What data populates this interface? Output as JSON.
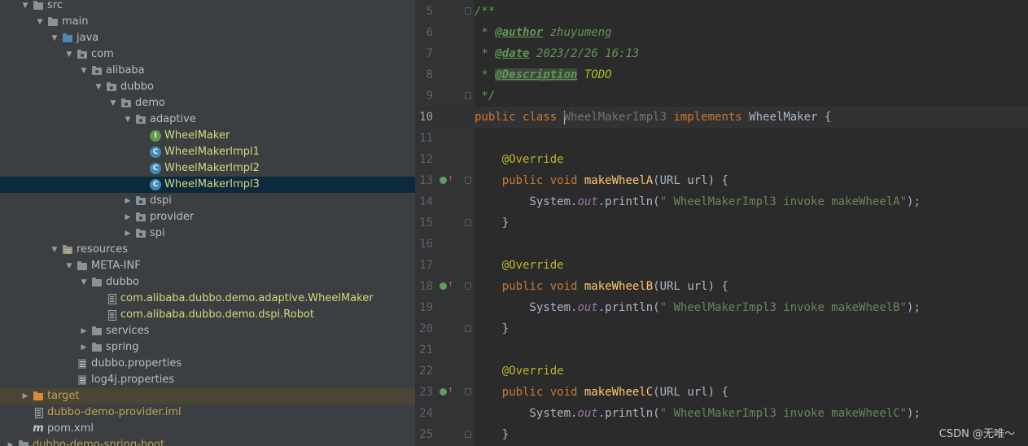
{
  "tree": [
    {
      "label": "src",
      "level": 1,
      "arrow": "open",
      "icon": "folder-icon"
    },
    {
      "label": "main",
      "level": 2,
      "arrow": "open",
      "icon": "folder-icon"
    },
    {
      "label": "java",
      "level": 3,
      "arrow": "open",
      "icon": "source-folder-icon"
    },
    {
      "label": "com",
      "level": 4,
      "arrow": "open",
      "icon": "package-icon"
    },
    {
      "label": "alibaba",
      "level": 5,
      "arrow": "open",
      "icon": "package-icon"
    },
    {
      "label": "dubbo",
      "level": 6,
      "arrow": "open",
      "icon": "package-icon"
    },
    {
      "label": "demo",
      "level": 7,
      "arrow": "open",
      "icon": "package-icon"
    },
    {
      "label": "adaptive",
      "level": 8,
      "arrow": "open",
      "icon": "package-icon"
    },
    {
      "label": "WheelMaker",
      "level": 9,
      "arrow": "none",
      "icon": "interface-icon",
      "color": "green"
    },
    {
      "label": "WheelMakerImpl1",
      "level": 9,
      "arrow": "none",
      "icon": "class-icon",
      "color": "green"
    },
    {
      "label": "WheelMakerImpl2",
      "level": 9,
      "arrow": "none",
      "icon": "class-icon",
      "color": "green"
    },
    {
      "label": "WheelMakerImpl3",
      "level": 9,
      "arrow": "none",
      "icon": "class-icon",
      "color": "green",
      "selected": true
    },
    {
      "label": "dspi",
      "level": 8,
      "arrow": "closed",
      "icon": "package-icon"
    },
    {
      "label": "provider",
      "level": 8,
      "arrow": "closed",
      "icon": "package-icon"
    },
    {
      "label": "spi",
      "level": 8,
      "arrow": "closed",
      "icon": "package-icon"
    },
    {
      "label": "resources",
      "level": 3,
      "arrow": "open",
      "icon": "resources-folder-icon"
    },
    {
      "label": "META-INF",
      "level": 4,
      "arrow": "open",
      "icon": "folder-icon"
    },
    {
      "label": "dubbo",
      "level": 5,
      "arrow": "open",
      "icon": "folder-icon"
    },
    {
      "label": "com.alibaba.dubbo.demo.adaptive.WheelMaker",
      "level": 6,
      "arrow": "none",
      "icon": "file-icon",
      "color": "green"
    },
    {
      "label": "com.alibaba.dubbo.demo.dspi.Robot",
      "level": 6,
      "arrow": "none",
      "icon": "file-icon",
      "color": "green"
    },
    {
      "label": "services",
      "level": 5,
      "arrow": "closed",
      "icon": "folder-icon"
    },
    {
      "label": "spring",
      "level": 5,
      "arrow": "closed",
      "icon": "folder-icon"
    },
    {
      "label": "dubbo.properties",
      "level": 4,
      "arrow": "none",
      "icon": "properties-icon"
    },
    {
      "label": "log4j.properties",
      "level": 4,
      "arrow": "none",
      "icon": "properties-icon"
    },
    {
      "label": "target",
      "level": 1,
      "arrow": "closed",
      "icon": "target-folder-icon",
      "color": "orange",
      "excluded": true
    },
    {
      "label": "dubbo-demo-provider.iml",
      "level": 1,
      "arrow": "none",
      "icon": "iml-file-icon",
      "color": "orange"
    },
    {
      "label": "pom.xml",
      "level": 1,
      "arrow": "none",
      "icon": "maven-icon"
    },
    {
      "label": "dubbo-demo-spring-boot",
      "level": 0,
      "arrow": "closed",
      "icon": "folder-icon",
      "color": "orange"
    }
  ],
  "editor": {
    "current_line": "10",
    "lines": [
      {
        "no": "5",
        "fold": "open",
        "tokens": [
          [
            "cm",
            "/**"
          ]
        ]
      },
      {
        "no": "6",
        "tokens": [
          [
            "cm",
            " * "
          ],
          [
            "tag",
            "@author"
          ],
          [
            "cm",
            " zhuyumeng"
          ]
        ]
      },
      {
        "no": "7",
        "tokens": [
          [
            "cm",
            " * "
          ],
          [
            "tag",
            "@date"
          ],
          [
            "cm",
            " 2023/2/26 16:13"
          ]
        ]
      },
      {
        "no": "8",
        "tokens": [
          [
            "cm",
            " * "
          ],
          [
            "tag tagbox",
            "@Description"
          ],
          [
            "cm",
            " "
          ],
          [
            "todo",
            "TODO"
          ]
        ]
      },
      {
        "no": "9",
        "fold": "close",
        "tokens": [
          [
            "cm",
            " */"
          ]
        ]
      },
      {
        "no": "10",
        "current": true,
        "tokens": [
          [
            "kw",
            "public class "
          ],
          [
            "caret",
            ""
          ],
          [
            "cls-unused",
            "WheelMakerImpl3"
          ],
          [
            "kw",
            " implements "
          ],
          [
            "pl",
            "WheelMaker {"
          ]
        ]
      },
      {
        "no": "11",
        "tokens": []
      },
      {
        "no": "12",
        "tokens": [
          [
            "pl",
            "    "
          ],
          [
            "ann",
            "@Override"
          ]
        ]
      },
      {
        "no": "13",
        "fold": "open",
        "impl": true,
        "tokens": [
          [
            "pl",
            "    "
          ],
          [
            "kw",
            "public void "
          ],
          [
            "fn",
            "makeWheelA"
          ],
          [
            "pl",
            "(URL url) {"
          ]
        ]
      },
      {
        "no": "14",
        "tokens": [
          [
            "pl",
            "        System."
          ],
          [
            "st",
            "out"
          ],
          [
            "pl",
            ".println("
          ],
          [
            "str",
            "\" WheelMakerImpl3 invoke makeWheelA\""
          ],
          [
            "pl",
            ");"
          ]
        ]
      },
      {
        "no": "15",
        "fold": "close",
        "tokens": [
          [
            "pl",
            "    }"
          ]
        ]
      },
      {
        "no": "16",
        "tokens": []
      },
      {
        "no": "17",
        "tokens": [
          [
            "pl",
            "    "
          ],
          [
            "ann",
            "@Override"
          ]
        ]
      },
      {
        "no": "18",
        "fold": "open",
        "impl": true,
        "tokens": [
          [
            "pl",
            "    "
          ],
          [
            "kw",
            "public void "
          ],
          [
            "fn",
            "makeWheelB"
          ],
          [
            "pl",
            "(URL url) {"
          ]
        ]
      },
      {
        "no": "19",
        "tokens": [
          [
            "pl",
            "        System."
          ],
          [
            "st",
            "out"
          ],
          [
            "pl",
            ".println("
          ],
          [
            "str",
            "\" WheelMakerImpl3 invoke makeWheelB\""
          ],
          [
            "pl",
            ");"
          ]
        ]
      },
      {
        "no": "20",
        "fold": "close",
        "tokens": [
          [
            "pl",
            "    }"
          ]
        ]
      },
      {
        "no": "21",
        "tokens": []
      },
      {
        "no": "22",
        "tokens": [
          [
            "pl",
            "    "
          ],
          [
            "ann",
            "@Override"
          ]
        ]
      },
      {
        "no": "23",
        "fold": "open",
        "impl": true,
        "tokens": [
          [
            "pl",
            "    "
          ],
          [
            "kw",
            "public void "
          ],
          [
            "fn",
            "makeWheelC"
          ],
          [
            "pl",
            "(URL url) {"
          ]
        ]
      },
      {
        "no": "24",
        "tokens": [
          [
            "pl",
            "        System."
          ],
          [
            "st",
            "out"
          ],
          [
            "pl",
            ".println("
          ],
          [
            "str",
            "\" WheelMakerImpl3 invoke makeWheelC\""
          ],
          [
            "pl",
            ");"
          ]
        ]
      },
      {
        "no": "25",
        "fold": "close",
        "tokens": [
          [
            "pl",
            "    }"
          ]
        ]
      }
    ]
  },
  "watermark": "CSDN @无唯～",
  "colors": {
    "tree_bg": "#3c3f41",
    "editor_bg": "#2b2b2b",
    "gutter_bg": "#313335",
    "selection": "#0d293e",
    "keyword": "#cc7832",
    "comment": "#629755",
    "annotation": "#bbb529",
    "method": "#ffc66d",
    "string": "#6a8759"
  }
}
